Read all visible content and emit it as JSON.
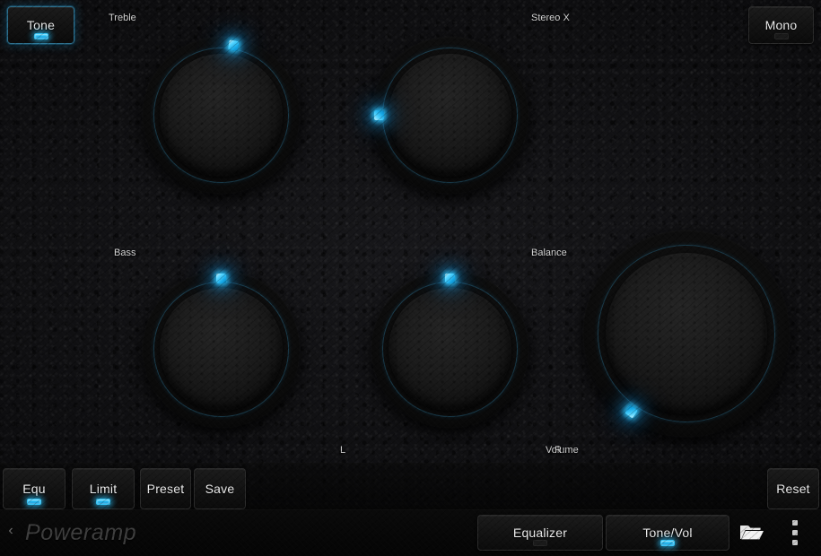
{
  "app": {
    "brand": "Poweramp",
    "back_icon": "‹",
    "accent_color": "#29c3f6",
    "background_color": "#111111"
  },
  "top_buttons": [
    {
      "name": "tone",
      "label": "Tone",
      "indicator": "on",
      "focused": true
    },
    {
      "name": "mono",
      "label": "Mono",
      "indicator": "off",
      "focused": false
    }
  ],
  "knobs": [
    {
      "name": "treble",
      "label": "Treble",
      "angle": 10,
      "value_angle_deg": 10
    },
    {
      "name": "stereo-x",
      "label": "Stereo X",
      "angle": -90,
      "value_angle_deg": -90
    },
    {
      "name": "bass",
      "label": "Bass",
      "angle": 0,
      "value_angle_deg": 0
    },
    {
      "name": "balance",
      "label": "Balance",
      "angle": 0,
      "value_angle_deg": 0
    },
    {
      "name": "volume",
      "label": "Volume",
      "angle": -145,
      "value_angle_deg": -145
    }
  ],
  "channel_labels": {
    "left": "L",
    "right": "R"
  },
  "preset_bar": [
    {
      "name": "equ",
      "label": "Equ",
      "indicator": "on"
    },
    {
      "name": "limit",
      "label": "Limit",
      "indicator": "on"
    },
    {
      "name": "preset",
      "label": "Preset",
      "indicator": "none"
    },
    {
      "name": "save",
      "label": "Save",
      "indicator": "none"
    },
    {
      "name": "reset",
      "label": "Reset",
      "indicator": "none"
    }
  ],
  "nav_bar": {
    "equalizer": {
      "label": "Equalizer",
      "indicator": "off"
    },
    "tone_vol": {
      "label": "Tone/Vol",
      "indicator": "on"
    },
    "folder_icon": "folder-open-icon",
    "overflow_icon": "overflow-menu-icon"
  }
}
